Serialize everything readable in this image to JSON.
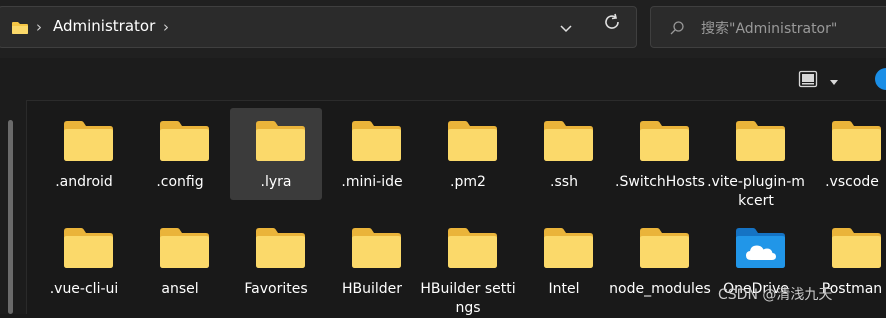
{
  "address_bar": {
    "breadcrumb": [
      {
        "name": "folder-icon"
      },
      {
        "separator": "›"
      },
      {
        "label": "Administrator"
      },
      {
        "separator": "›"
      }
    ],
    "label": "Administrator",
    "dropdown_icon": "chevron-down-icon",
    "refresh_icon": "refresh-icon"
  },
  "search": {
    "placeholder": "搜索\"Administrator\"",
    "icon": "search-icon"
  },
  "toolbar": {
    "cut_text": "“",
    "view_icon": "details-view-icon",
    "dropdown_icon": "chevron-down-icon",
    "help_icon": "help-icon"
  },
  "files": [
    {
      "label": ".android",
      "selected": false
    },
    {
      "label": ".config",
      "selected": false
    },
    {
      "label": ".lyra",
      "selected": true
    },
    {
      "label": ".mini-ide",
      "selected": false
    },
    {
      "label": ".pm2",
      "selected": false
    },
    {
      "label": ".ssh",
      "selected": false
    },
    {
      "label": ".SwitchHosts",
      "selected": false
    },
    {
      "label": ".vite-plugin-mkcert",
      "selected": false
    },
    {
      "label": ".vscode",
      "selected": false
    },
    {
      "label": ".vue-cli-ui",
      "selected": false
    },
    {
      "label": "ansel",
      "selected": false
    },
    {
      "label": "Favorites",
      "selected": false
    },
    {
      "label": "HBuilder",
      "selected": false
    },
    {
      "label": "HBuilder settings",
      "selected": false
    },
    {
      "label": "Intel",
      "selected": false
    },
    {
      "label": "node_modules",
      "selected": false
    },
    {
      "label": "OneDrive",
      "selected": false,
      "icon": "onedrive-folder-icon"
    },
    {
      "label": "Postman",
      "selected": false
    }
  ],
  "watermark": "CSDN @清浅九天",
  "colors": {
    "folder": "#f5c645",
    "folder_light": "#fbd96a",
    "onedrive_folder": "#1c8adb",
    "selected_tile": "#3b3b3b",
    "background": "#191919"
  }
}
